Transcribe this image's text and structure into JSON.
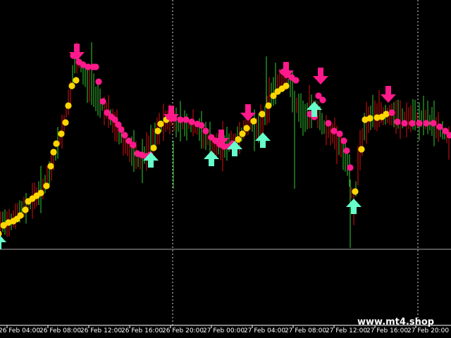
{
  "chart_data": {
    "type": "candlestick",
    "grid": "dashed vertical lines",
    "legend": "none",
    "x_tick_labels": [
      "26 Feb 04:00",
      "26 Feb 08:00",
      "26 Feb 12:00",
      "26 Feb 16:00",
      "26 Feb 20:00",
      "27 Feb 00:00",
      "27 Feb 04:00",
      "27 Feb 08:00",
      "27 Feb 12:00",
      "27 Feb 16:00",
      "27 Feb 20:00"
    ],
    "colors": {
      "bull": "#33cc33",
      "bear": "#dd1111",
      "dots_up": "#ffd700",
      "dots_down": "#ff1a8c",
      "arrow_buy": "#66ffcc",
      "arrow_sell": "#ff1a8c",
      "grid": "#ffffff",
      "background": "#000000"
    },
    "price_path": [
      [
        0,
        320
      ],
      [
        15,
        312
      ],
      [
        30,
        300
      ],
      [
        45,
        285
      ],
      [
        60,
        268
      ],
      [
        70,
        248
      ],
      [
        80,
        215
      ],
      [
        90,
        180
      ],
      [
        100,
        130
      ],
      [
        107,
        82
      ],
      [
        115,
        95
      ],
      [
        125,
        120
      ],
      [
        140,
        140
      ],
      [
        155,
        165
      ],
      [
        170,
        190
      ],
      [
        185,
        215
      ],
      [
        200,
        230
      ],
      [
        210,
        215
      ],
      [
        225,
        185
      ],
      [
        235,
        170
      ],
      [
        250,
        172
      ],
      [
        270,
        178
      ],
      [
        290,
        190
      ],
      [
        305,
        210
      ],
      [
        320,
        205
      ],
      [
        335,
        200
      ],
      [
        345,
        185
      ],
      [
        355,
        175
      ],
      [
        370,
        185
      ],
      [
        380,
        150
      ],
      [
        390,
        120
      ],
      [
        405,
        108
      ],
      [
        420,
        150
      ],
      [
        432,
        170
      ],
      [
        445,
        150
      ],
      [
        460,
        180
      ],
      [
        480,
        200
      ],
      [
        495,
        240
      ],
      [
        502,
        298
      ],
      [
        510,
        215
      ],
      [
        520,
        170
      ],
      [
        540,
        160
      ],
      [
        555,
        165
      ],
      [
        575,
        170
      ],
      [
        600,
        168
      ],
      [
        615,
        175
      ],
      [
        640,
        200
      ]
    ],
    "dot_series": [
      {
        "name": "",
        "color": "yellow",
        "points": [
          [
            -2,
            332
          ],
          [
            5,
            320
          ],
          [
            12,
            316
          ],
          [
            19,
            314
          ],
          [
            24,
            311
          ],
          [
            29,
            306
          ],
          [
            36,
            298
          ],
          [
            40,
            286
          ],
          [
            46,
            282
          ],
          [
            52,
            278
          ],
          [
            58,
            274
          ],
          [
            66,
            264
          ],
          [
            72,
            236
          ],
          [
            76,
            216
          ],
          [
            80,
            204
          ],
          [
            87,
            190
          ],
          [
            93,
            174
          ],
          [
            97,
            150
          ],
          [
            102,
            122
          ],
          [
            108,
            114
          ],
          [
            218,
            210
          ],
          [
            224,
            186
          ],
          [
            228,
            176
          ],
          [
            236,
            170
          ],
          [
            338,
            198
          ],
          [
            344,
            190
          ],
          [
            350,
            182
          ],
          [
            360,
            172
          ],
          [
            372,
            162
          ],
          [
            381,
            150
          ],
          [
            388,
            136
          ],
          [
            394,
            130
          ],
          [
            400,
            126
          ],
          [
            406,
            122
          ],
          [
            513,
            212
          ],
          [
            518,
            170
          ],
          [
            525,
            168
          ],
          [
            535,
            167
          ],
          [
            542,
            166
          ],
          [
            548,
            162
          ],
          [
            504,
            272
          ]
        ]
      },
      {
        "name": "",
        "color": "pink",
        "points": [
          [
            104,
            79
          ],
          [
            112,
            88
          ],
          [
            118,
            92
          ],
          [
            125,
            95
          ],
          [
            132,
            95
          ],
          [
            136,
            95
          ],
          [
            140,
            116
          ],
          [
            146,
            144
          ],
          [
            152,
            160
          ],
          [
            158,
            166
          ],
          [
            163,
            170
          ],
          [
            168,
            177
          ],
          [
            172,
            184
          ],
          [
            177,
            192
          ],
          [
            183,
            200
          ],
          [
            189,
            206
          ],
          [
            195,
            218
          ],
          [
            201,
            220
          ],
          [
            207,
            222
          ],
          [
            213,
            220
          ],
          [
            240,
            166
          ],
          [
            247,
            168
          ],
          [
            256,
            170
          ],
          [
            264,
            170
          ],
          [
            272,
            173
          ],
          [
            280,
            176
          ],
          [
            286,
            178
          ],
          [
            292,
            186
          ],
          [
            300,
            195
          ],
          [
            306,
            200
          ],
          [
            312,
            205
          ],
          [
            318,
            208
          ],
          [
            325,
            208
          ],
          [
            330,
            204
          ],
          [
            402,
            102
          ],
          [
            408,
            106
          ],
          [
            414,
            110
          ],
          [
            420,
            114
          ],
          [
            440,
            162
          ],
          [
            446,
            166
          ],
          [
            452,
            136
          ],
          [
            458,
            142
          ],
          [
            466,
            175
          ],
          [
            474,
            186
          ],
          [
            482,
            190
          ],
          [
            488,
            200
          ],
          [
            492,
            214
          ],
          [
            497,
            238
          ],
          [
            556,
            160
          ],
          [
            564,
            173
          ],
          [
            574,
            175
          ],
          [
            585,
            175
          ],
          [
            595,
            175
          ],
          [
            605,
            175
          ],
          [
            615,
            175
          ],
          [
            624,
            180
          ],
          [
            632,
            186
          ],
          [
            638,
            192
          ]
        ]
      }
    ],
    "buy_arrows": [
      [
        -2,
        344
      ],
      [
        214,
        228
      ],
      [
        300,
        226
      ],
      [
        333,
        212
      ],
      [
        373,
        200
      ],
      [
        446,
        156
      ],
      [
        502,
        294
      ]
    ],
    "sell_arrows": [
      [
        109,
        74
      ],
      [
        243,
        162
      ],
      [
        314,
        196
      ],
      [
        352,
        160
      ],
      [
        406,
        100
      ],
      [
        455,
        108
      ],
      [
        551,
        134
      ]
    ]
  },
  "watermark": "www.mt4.shop"
}
